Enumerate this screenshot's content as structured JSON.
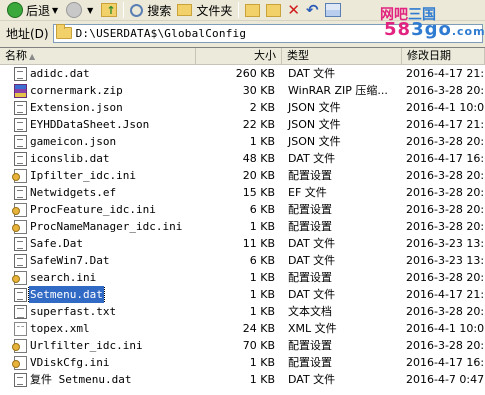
{
  "toolbar": {
    "back_label": "后退",
    "search_label": "搜索",
    "folders_label": "文件夹"
  },
  "address": {
    "label": "地址(D)",
    "path": "D:\\USERDATA$\\GlobalConfig"
  },
  "watermark": {
    "top_a": "网吧",
    "top_b": "三国",
    "bottom_a": "58",
    "bottom_b": "3go",
    "bottom_c": ".com"
  },
  "columns": {
    "name": "名称",
    "size": "大小",
    "type": "类型",
    "date": "修改日期"
  },
  "files": [
    {
      "name": "adidc.dat",
      "size": "260 KB",
      "type": "DAT 文件",
      "date": "2016-4-17 21:",
      "icon": "doc"
    },
    {
      "name": "cornermark.zip",
      "size": "30 KB",
      "type": "WinRAR ZIP 压缩...",
      "date": "2016-3-28 20:",
      "icon": "zip"
    },
    {
      "name": "Extension.json",
      "size": "2 KB",
      "type": "JSON 文件",
      "date": "2016-4-1 10:0",
      "icon": "doc"
    },
    {
      "name": "EYHDDataSheet.Json",
      "size": "22 KB",
      "type": "JSON 文件",
      "date": "2016-4-17 21:",
      "icon": "doc"
    },
    {
      "name": "gameicon.json",
      "size": "1 KB",
      "type": "JSON 文件",
      "date": "2016-3-28 20:",
      "icon": "doc"
    },
    {
      "name": "iconslib.dat",
      "size": "48 KB",
      "type": "DAT 文件",
      "date": "2016-4-17 16:",
      "icon": "doc"
    },
    {
      "name": "Ipfilter_idc.ini",
      "size": "20 KB",
      "type": "配置设置",
      "date": "2016-3-28 20:",
      "icon": "cfg"
    },
    {
      "name": "Netwidgets.ef",
      "size": "15 KB",
      "type": "EF 文件",
      "date": "2016-3-28 20:",
      "icon": "doc"
    },
    {
      "name": "ProcFeature_idc.ini",
      "size": "6 KB",
      "type": "配置设置",
      "date": "2016-3-28 20:",
      "icon": "cfg"
    },
    {
      "name": "ProcNameManager_idc.ini",
      "size": "1 KB",
      "type": "配置设置",
      "date": "2016-3-28 20:",
      "icon": "cfg"
    },
    {
      "name": "Safe.Dat",
      "size": "11 KB",
      "type": "DAT 文件",
      "date": "2016-3-23 13:",
      "icon": "doc"
    },
    {
      "name": "SafeWin7.Dat",
      "size": "6 KB",
      "type": "DAT 文件",
      "date": "2016-3-23 13:",
      "icon": "doc"
    },
    {
      "name": "search.ini",
      "size": "1 KB",
      "type": "配置设置",
      "date": "2016-3-28 20:",
      "icon": "cfg"
    },
    {
      "name": "Setmenu.dat",
      "size": "1 KB",
      "type": "DAT 文件",
      "date": "2016-4-17 21:",
      "icon": "doc",
      "selected": true
    },
    {
      "name": "superfast.txt",
      "size": "1 KB",
      "type": "文本文档",
      "date": "2016-3-28 20:",
      "icon": "txt"
    },
    {
      "name": "topex.xml",
      "size": "24 KB",
      "type": "XML 文件",
      "date": "2016-4-1 10:0",
      "icon": "xml"
    },
    {
      "name": "Urlfilter_idc.ini",
      "size": "70 KB",
      "type": "配置设置",
      "date": "2016-3-28 20:",
      "icon": "cfg"
    },
    {
      "name": "VDiskCfg.ini",
      "size": "1 KB",
      "type": "配置设置",
      "date": "2016-4-17 16:",
      "icon": "cfg"
    },
    {
      "name": "复件 Setmenu.dat",
      "size": "1 KB",
      "type": "DAT 文件",
      "date": "2016-4-7 0:47",
      "icon": "doc"
    }
  ]
}
